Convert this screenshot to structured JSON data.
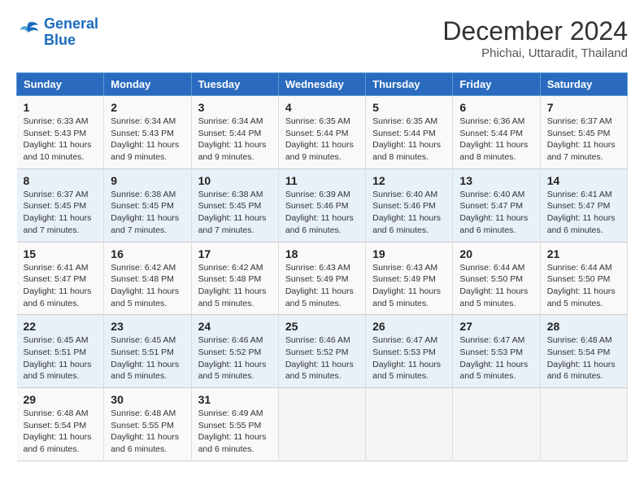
{
  "header": {
    "logo_line1": "General",
    "logo_line2": "Blue",
    "month": "December 2024",
    "location": "Phichai, Uttaradit, Thailand"
  },
  "columns": [
    "Sunday",
    "Monday",
    "Tuesday",
    "Wednesday",
    "Thursday",
    "Friday",
    "Saturday"
  ],
  "weeks": [
    [
      {
        "day": "1",
        "text": "Sunrise: 6:33 AM\nSunset: 5:43 PM\nDaylight: 11 hours and 10 minutes."
      },
      {
        "day": "2",
        "text": "Sunrise: 6:34 AM\nSunset: 5:43 PM\nDaylight: 11 hours and 9 minutes."
      },
      {
        "day": "3",
        "text": "Sunrise: 6:34 AM\nSunset: 5:44 PM\nDaylight: 11 hours and 9 minutes."
      },
      {
        "day": "4",
        "text": "Sunrise: 6:35 AM\nSunset: 5:44 PM\nDaylight: 11 hours and 9 minutes."
      },
      {
        "day": "5",
        "text": "Sunrise: 6:35 AM\nSunset: 5:44 PM\nDaylight: 11 hours and 8 minutes."
      },
      {
        "day": "6",
        "text": "Sunrise: 6:36 AM\nSunset: 5:44 PM\nDaylight: 11 hours and 8 minutes."
      },
      {
        "day": "7",
        "text": "Sunrise: 6:37 AM\nSunset: 5:45 PM\nDaylight: 11 hours and 7 minutes."
      }
    ],
    [
      {
        "day": "8",
        "text": "Sunrise: 6:37 AM\nSunset: 5:45 PM\nDaylight: 11 hours and 7 minutes."
      },
      {
        "day": "9",
        "text": "Sunrise: 6:38 AM\nSunset: 5:45 PM\nDaylight: 11 hours and 7 minutes."
      },
      {
        "day": "10",
        "text": "Sunrise: 6:38 AM\nSunset: 5:45 PM\nDaylight: 11 hours and 7 minutes."
      },
      {
        "day": "11",
        "text": "Sunrise: 6:39 AM\nSunset: 5:46 PM\nDaylight: 11 hours and 6 minutes."
      },
      {
        "day": "12",
        "text": "Sunrise: 6:40 AM\nSunset: 5:46 PM\nDaylight: 11 hours and 6 minutes."
      },
      {
        "day": "13",
        "text": "Sunrise: 6:40 AM\nSunset: 5:47 PM\nDaylight: 11 hours and 6 minutes."
      },
      {
        "day": "14",
        "text": "Sunrise: 6:41 AM\nSunset: 5:47 PM\nDaylight: 11 hours and 6 minutes."
      }
    ],
    [
      {
        "day": "15",
        "text": "Sunrise: 6:41 AM\nSunset: 5:47 PM\nDaylight: 11 hours and 6 minutes."
      },
      {
        "day": "16",
        "text": "Sunrise: 6:42 AM\nSunset: 5:48 PM\nDaylight: 11 hours and 5 minutes."
      },
      {
        "day": "17",
        "text": "Sunrise: 6:42 AM\nSunset: 5:48 PM\nDaylight: 11 hours and 5 minutes."
      },
      {
        "day": "18",
        "text": "Sunrise: 6:43 AM\nSunset: 5:49 PM\nDaylight: 11 hours and 5 minutes."
      },
      {
        "day": "19",
        "text": "Sunrise: 6:43 AM\nSunset: 5:49 PM\nDaylight: 11 hours and 5 minutes."
      },
      {
        "day": "20",
        "text": "Sunrise: 6:44 AM\nSunset: 5:50 PM\nDaylight: 11 hours and 5 minutes."
      },
      {
        "day": "21",
        "text": "Sunrise: 6:44 AM\nSunset: 5:50 PM\nDaylight: 11 hours and 5 minutes."
      }
    ],
    [
      {
        "day": "22",
        "text": "Sunrise: 6:45 AM\nSunset: 5:51 PM\nDaylight: 11 hours and 5 minutes."
      },
      {
        "day": "23",
        "text": "Sunrise: 6:45 AM\nSunset: 5:51 PM\nDaylight: 11 hours and 5 minutes."
      },
      {
        "day": "24",
        "text": "Sunrise: 6:46 AM\nSunset: 5:52 PM\nDaylight: 11 hours and 5 minutes."
      },
      {
        "day": "25",
        "text": "Sunrise: 6:46 AM\nSunset: 5:52 PM\nDaylight: 11 hours and 5 minutes."
      },
      {
        "day": "26",
        "text": "Sunrise: 6:47 AM\nSunset: 5:53 PM\nDaylight: 11 hours and 5 minutes."
      },
      {
        "day": "27",
        "text": "Sunrise: 6:47 AM\nSunset: 5:53 PM\nDaylight: 11 hours and 5 minutes."
      },
      {
        "day": "28",
        "text": "Sunrise: 6:48 AM\nSunset: 5:54 PM\nDaylight: 11 hours and 6 minutes."
      }
    ],
    [
      {
        "day": "29",
        "text": "Sunrise: 6:48 AM\nSunset: 5:54 PM\nDaylight: 11 hours and 6 minutes."
      },
      {
        "day": "30",
        "text": "Sunrise: 6:48 AM\nSunset: 5:55 PM\nDaylight: 11 hours and 6 minutes."
      },
      {
        "day": "31",
        "text": "Sunrise: 6:49 AM\nSunset: 5:55 PM\nDaylight: 11 hours and 6 minutes."
      },
      {
        "day": "",
        "text": ""
      },
      {
        "day": "",
        "text": ""
      },
      {
        "day": "",
        "text": ""
      },
      {
        "day": "",
        "text": ""
      }
    ]
  ]
}
